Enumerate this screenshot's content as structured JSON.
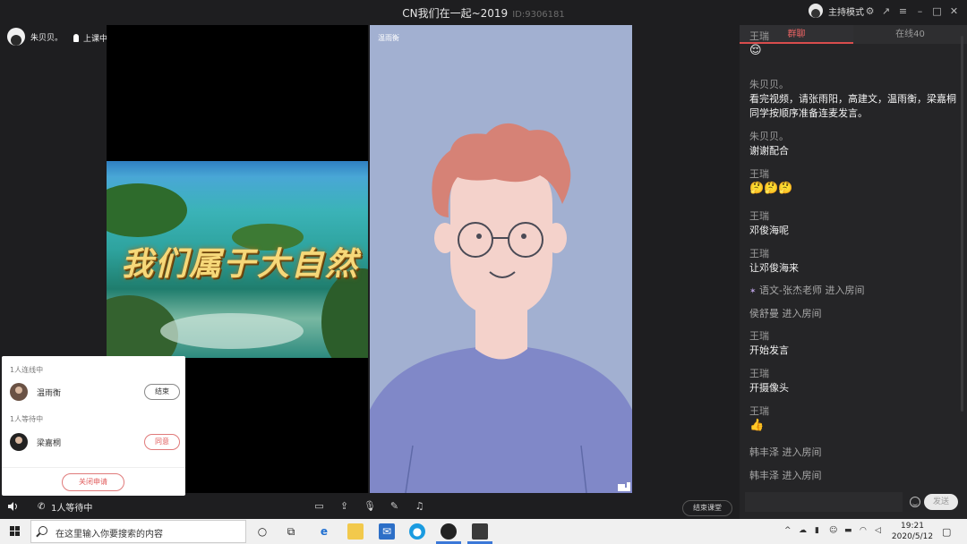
{
  "window": {
    "title_prefix": "CN",
    "title": "我们在一起~2019",
    "room_id": "ID:9306181",
    "host_mode_label": "主持模式"
  },
  "host": {
    "name": "朱贝贝。",
    "class_status": "上课中"
  },
  "video_right": {
    "participant_name": "温雨衡"
  },
  "video_left": {
    "caption": "我们属于大自然"
  },
  "chat_panel": {
    "tabs": [
      {
        "label": "群聊",
        "active": true
      },
      {
        "label": "在线40",
        "active": false
      }
    ],
    "messages": [
      {
        "who": "王瑞",
        "text": "😌"
      },
      {
        "who": "朱贝贝。",
        "text": "看完视频，请张雨阳，高建文，温雨衡，梁嘉桐同学按顺序准备连麦发言。"
      },
      {
        "who": "朱贝贝。",
        "text": "谢谢配合"
      },
      {
        "who": "王瑞",
        "text": "🤔🤔🤔"
      },
      {
        "who": "王瑞",
        "text": "邓俊海呢"
      },
      {
        "who": "王瑞",
        "text": "让邓俊海来"
      },
      {
        "system": "语文-张杰老师 进入房间"
      },
      {
        "system": "侯舒曼 进入房间"
      },
      {
        "who": "王瑞",
        "text": "开始发言"
      },
      {
        "who": "王瑞",
        "text": "开摄像头"
      },
      {
        "who": "王瑞",
        "text": "👍"
      },
      {
        "system": "韩丰泽 进入房间"
      },
      {
        "system": "韩丰泽 进入房间"
      }
    ],
    "send_label": "发送"
  },
  "bottom_bar": {
    "waiting_label": "1人等待中",
    "end_class_label": "结束课堂"
  },
  "connect_popup": {
    "connected_header": "1人连线中",
    "connected": [
      {
        "name": "温雨衡",
        "action": "结束"
      }
    ],
    "waiting_header": "1人等待中",
    "waiting": [
      {
        "name": "梁嘉桐",
        "action": "同意"
      }
    ],
    "close_apply_label": "关闭申请"
  },
  "taskbar": {
    "search_placeholder": "在这里输入你要搜索的内容",
    "time": "19:21",
    "date": "2020/5/12"
  }
}
